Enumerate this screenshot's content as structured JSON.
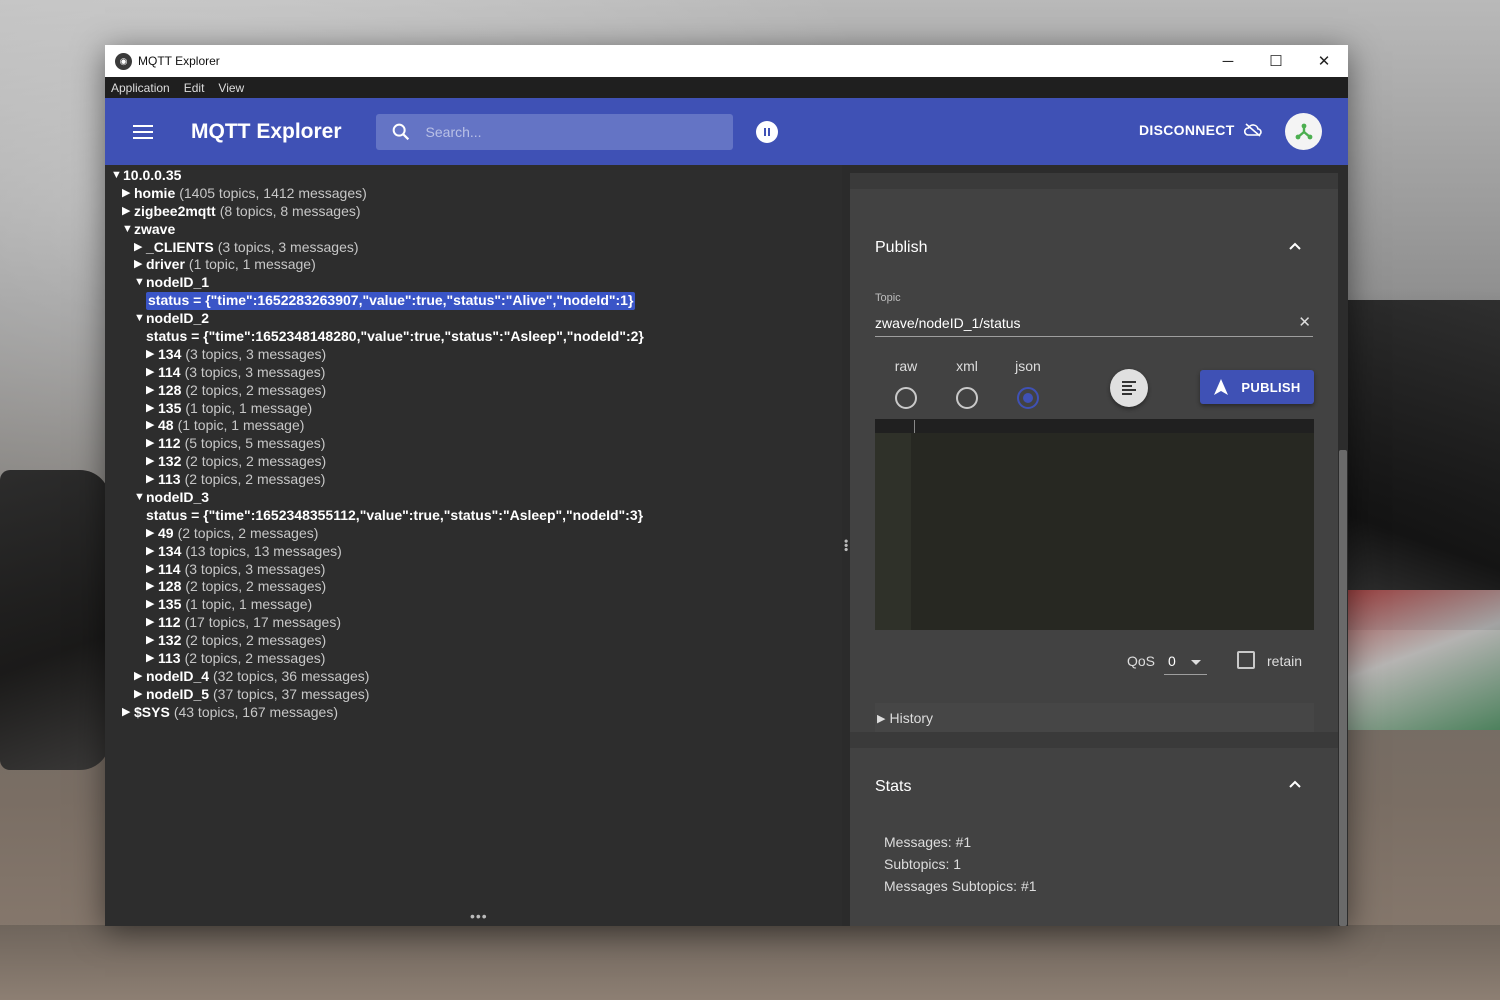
{
  "window": {
    "title": "MQTT Explorer"
  },
  "menu": [
    "Application",
    "Edit",
    "View"
  ],
  "appbar": {
    "brand": "MQTT Explorer",
    "search_placeholder": "Search...",
    "disconnect_label": "DISCONNECT"
  },
  "tree": [
    {
      "indent": 0,
      "arrow": "▼",
      "name": "10.0.0.35",
      "meta": ""
    },
    {
      "indent": 1,
      "arrow": "▶",
      "name": "homie",
      "meta": "(1405 topics, 1412 messages)"
    },
    {
      "indent": 1,
      "arrow": "▶",
      "name": "zigbee2mqtt",
      "meta": "(8 topics, 8 messages)"
    },
    {
      "indent": 1,
      "arrow": "▼",
      "name": "zwave",
      "meta": ""
    },
    {
      "indent": 2,
      "arrow": "▶",
      "name": "_CLIENTS",
      "meta": "(3 topics, 3 messages)"
    },
    {
      "indent": 2,
      "arrow": "▶",
      "name": "driver",
      "meta": "(1 topic, 1 message)"
    },
    {
      "indent": 2,
      "arrow": "▼",
      "name": "nodeID_1",
      "meta": ""
    },
    {
      "indent": 3,
      "value": "status = {\"time\":1652283263907,\"value\":true,\"status\":\"Alive\",\"nodeId\":1}",
      "selected": true
    },
    {
      "indent": 2,
      "arrow": "▼",
      "name": "nodeID_2",
      "meta": ""
    },
    {
      "indent": 3,
      "value": "status = {\"time\":1652348148280,\"value\":true,\"status\":\"Asleep\",\"nodeId\":2}"
    },
    {
      "indent": 3,
      "arrow": "▶",
      "name": "134",
      "meta": "(3 topics, 3 messages)"
    },
    {
      "indent": 3,
      "arrow": "▶",
      "name": "114",
      "meta": "(3 topics, 3 messages)"
    },
    {
      "indent": 3,
      "arrow": "▶",
      "name": "128",
      "meta": "(2 topics, 2 messages)"
    },
    {
      "indent": 3,
      "arrow": "▶",
      "name": "135",
      "meta": "(1 topic, 1 message)"
    },
    {
      "indent": 3,
      "arrow": "▶",
      "name": "48",
      "meta": "(1 topic, 1 message)"
    },
    {
      "indent": 3,
      "arrow": "▶",
      "name": "112",
      "meta": "(5 topics, 5 messages)"
    },
    {
      "indent": 3,
      "arrow": "▶",
      "name": "132",
      "meta": "(2 topics, 2 messages)"
    },
    {
      "indent": 3,
      "arrow": "▶",
      "name": "113",
      "meta": "(2 topics, 2 messages)"
    },
    {
      "indent": 2,
      "arrow": "▼",
      "name": "nodeID_3",
      "meta": ""
    },
    {
      "indent": 3,
      "value": "status = {\"time\":1652348355112,\"value\":true,\"status\":\"Asleep\",\"nodeId\":3}"
    },
    {
      "indent": 3,
      "arrow": "▶",
      "name": "49",
      "meta": "(2 topics, 2 messages)"
    },
    {
      "indent": 3,
      "arrow": "▶",
      "name": "134",
      "meta": "(13 topics, 13 messages)"
    },
    {
      "indent": 3,
      "arrow": "▶",
      "name": "114",
      "meta": "(3 topics, 3 messages)"
    },
    {
      "indent": 3,
      "arrow": "▶",
      "name": "128",
      "meta": "(2 topics, 2 messages)"
    },
    {
      "indent": 3,
      "arrow": "▶",
      "name": "135",
      "meta": "(1 topic, 1 message)"
    },
    {
      "indent": 3,
      "arrow": "▶",
      "name": "112",
      "meta": "(17 topics, 17 messages)"
    },
    {
      "indent": 3,
      "arrow": "▶",
      "name": "132",
      "meta": "(2 topics, 2 messages)"
    },
    {
      "indent": 3,
      "arrow": "▶",
      "name": "113",
      "meta": "(2 topics, 2 messages)"
    },
    {
      "indent": 2,
      "arrow": "▶",
      "name": "nodeID_4",
      "meta": "(32 topics, 36 messages)"
    },
    {
      "indent": 2,
      "arrow": "▶",
      "name": "nodeID_5",
      "meta": "(37 topics, 37 messages)"
    },
    {
      "indent": 1,
      "arrow": "▶",
      "name": "$SYS",
      "meta": "(43 topics, 167 messages)"
    }
  ],
  "publish": {
    "title": "Publish",
    "topic_label": "Topic",
    "topic_value": "zwave/nodeID_1/status",
    "formats": [
      "raw",
      "xml",
      "json"
    ],
    "selected_format": "json",
    "publish_label": "PUBLISH",
    "qos_label": "QoS",
    "qos_value": "0",
    "retain_label": "retain",
    "retain_checked": false,
    "history_label": "History"
  },
  "stats": {
    "title": "Stats",
    "lines": [
      "Messages: #1",
      "Subtopics: 1",
      "Messages Subtopics: #1"
    ]
  },
  "colors": {
    "appbar": "#3f51b5",
    "selection": "#3a55c7"
  }
}
